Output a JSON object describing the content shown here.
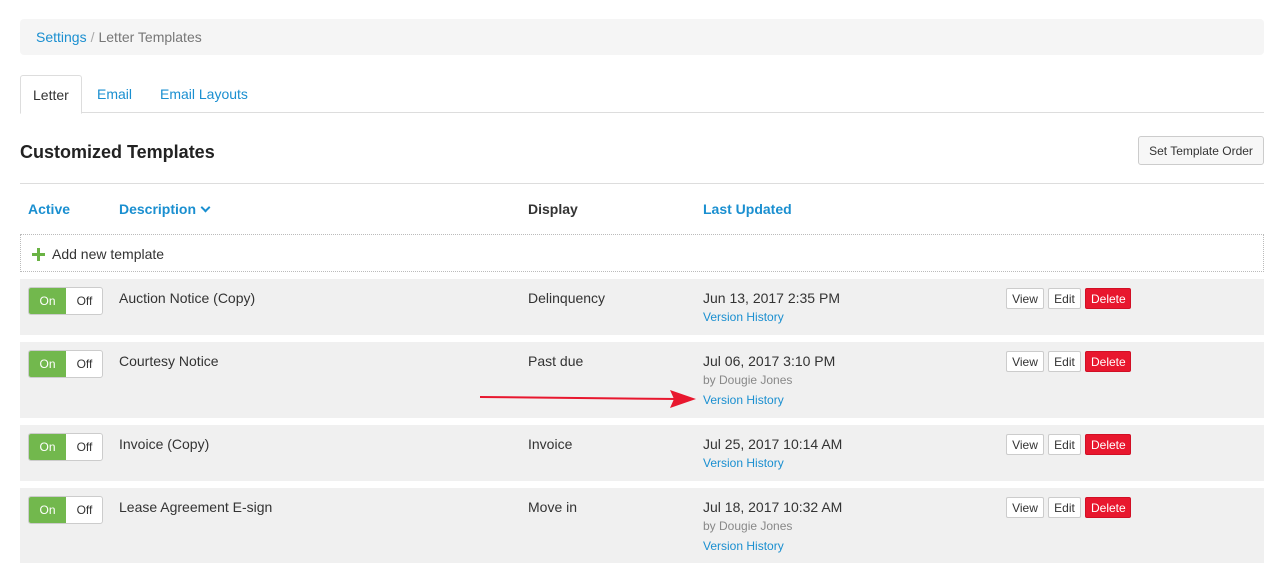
{
  "breadcrumb": {
    "root": "Settings",
    "separator": "/",
    "current": "Letter Templates"
  },
  "tabs": [
    {
      "label": "Letter",
      "active": true
    },
    {
      "label": "Email"
    },
    {
      "label": "Email Layouts"
    }
  ],
  "section": {
    "title": "Customized Templates",
    "order_button": "Set Template Order"
  },
  "columns": {
    "active": "Active",
    "description": "Description",
    "display": "Display",
    "last_updated": "Last Updated"
  },
  "add_label": "Add new template",
  "toggle": {
    "on": "On",
    "off": "Off"
  },
  "actions": {
    "view": "View",
    "edit": "Edit",
    "delete": "Delete"
  },
  "rows": [
    {
      "description": "Auction Notice (Copy)",
      "display": "Delinquency",
      "date": "Jun 13, 2017 2:35 PM",
      "by": "",
      "history": "Version History"
    },
    {
      "description": "Courtesy Notice",
      "display": "Past due",
      "date": "Jul 06, 2017 3:10 PM",
      "by": "by Dougie Jones",
      "history": "Version History"
    },
    {
      "description": "Invoice (Copy)",
      "display": "Invoice",
      "date": "Jul 25, 2017 10:14 AM",
      "by": "",
      "history": "Version History"
    },
    {
      "description": "Lease Agreement E-sign",
      "display": "Move in",
      "date": "Jul 18, 2017 10:32 AM",
      "by": "by Dougie Jones",
      "history": "Version History"
    }
  ],
  "colors": {
    "link": "#1a8fd0",
    "toggle_on": "#72b84d",
    "delete": "#e8172e",
    "arrow": "#e8172e"
  }
}
